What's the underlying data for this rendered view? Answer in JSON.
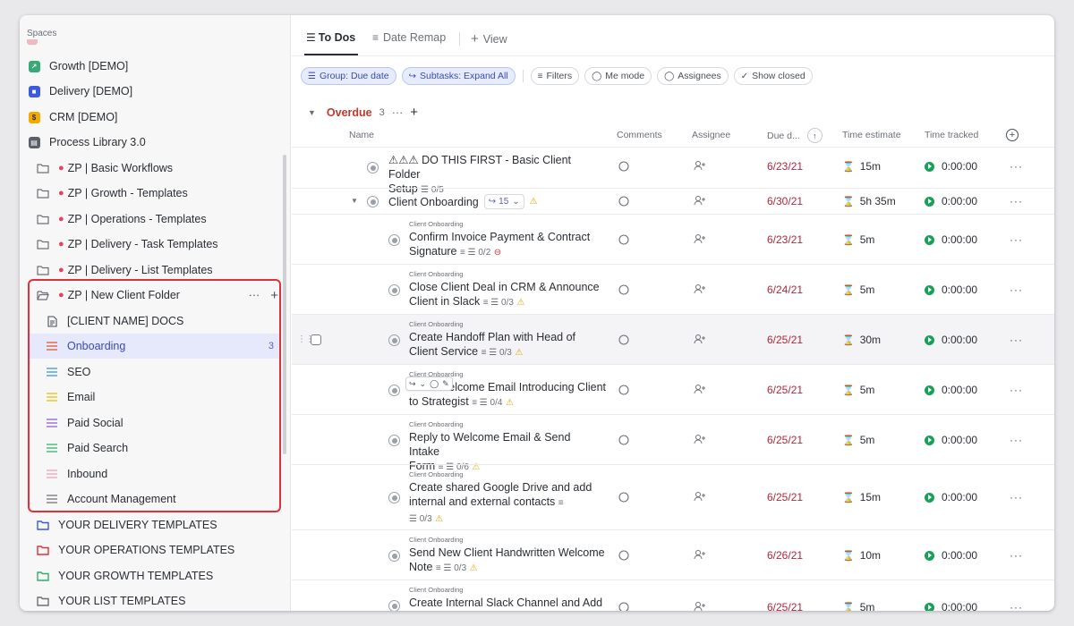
{
  "sidebar": {
    "spaces_label": "Spaces",
    "spaces": [
      {
        "label": "Growth [DEMO]",
        "color": "#3aa97a",
        "glyph": "⤴"
      },
      {
        "label": "Delivery [DEMO]",
        "color": "#3b5bdb",
        "glyph": "■"
      },
      {
        "label": "CRM [DEMO]",
        "color": "#f2a900",
        "glyph": "$"
      },
      {
        "label": "Process Library 3.0",
        "color": "#5a5f6a",
        "glyph": "▤"
      }
    ],
    "folders": [
      "ZP | Basic Workflows",
      "ZP | Growth - Templates",
      "ZP | Operations - Templates",
      "ZP | Delivery - Task Templates",
      "ZP | Delivery - List Templates"
    ],
    "open_folder": {
      "label": "ZP | New Client Folder",
      "more": "···",
      "add": "+"
    },
    "lists": [
      {
        "label": "[CLIENT NAME] DOCS",
        "type": "doc"
      },
      {
        "label": "Onboarding",
        "color": "#e0542b",
        "count": "3",
        "active": true
      },
      {
        "label": "SEO",
        "color": "#3b8fe0"
      },
      {
        "label": "Email",
        "color": "#e6c000"
      },
      {
        "label": "Paid Social",
        "color": "#8a5bd6"
      },
      {
        "label": "Paid Search",
        "color": "#2fae6b"
      },
      {
        "label": "Inbound",
        "color": "#f2a0b8"
      },
      {
        "label": "Account Management",
        "color": "#6b6f76"
      }
    ],
    "template_folders": [
      {
        "label": "YOUR DELIVERY TEMPLATES",
        "color": "#3b5bdb"
      },
      {
        "label": "YOUR OPERATIONS TEMPLATES",
        "color": "#e0303b"
      },
      {
        "label": "YOUR GROWTH TEMPLATES",
        "color": "#2fae6b"
      },
      {
        "label": "YOUR LIST TEMPLATES",
        "color": "#6b6f76"
      }
    ]
  },
  "tabs": {
    "todos": "To Dos",
    "date_remap": "Date Remap",
    "add_view": "View"
  },
  "toolbar": {
    "group": "Group: Due date",
    "subtasks": "Subtasks: Expand All",
    "filters": "Filters",
    "me_mode": "Me mode",
    "assignees": "Assignees",
    "show_closed": "Show closed"
  },
  "group": {
    "name": "Overdue",
    "count": "3",
    "more": "···",
    "add": "+"
  },
  "columns": {
    "name": "Name",
    "comments": "Comments",
    "assignee": "Assignee",
    "due": "Due d...",
    "time_estimate": "Time estimate",
    "time_tracked": "Time tracked"
  },
  "tasks": [
    {
      "parent": "",
      "line1": "⚠⚠⚠ DO THIS FIRST - Basic Client Folder",
      "line2": "Setup",
      "meta": "☰ 0/5",
      "flag": "",
      "due": "6/23/21",
      "estimate": "15m",
      "tracked": "0:00:00"
    },
    {
      "parent": "",
      "line1": "Client Onboarding",
      "line2": "",
      "meta": "15",
      "flag": "warn",
      "due": "6/30/21",
      "estimate": "5h 35m",
      "tracked": "0:00:00"
    },
    {
      "parent": "Client Onboarding",
      "line1": "Confirm Invoice Payment & Contract",
      "line2": "Signature",
      "meta": "≡ ☰ 0/2",
      "flag": "stop",
      "due": "6/23/21",
      "estimate": "5m",
      "tracked": "0:00:00"
    },
    {
      "parent": "Client Onboarding",
      "line1": "Close Client Deal in CRM & Announce",
      "line2": "Client in Slack",
      "meta": "≡ ☰ 0/3",
      "flag": "warn",
      "due": "6/24/21",
      "estimate": "5m",
      "tracked": "0:00:00"
    },
    {
      "parent": "Client Onboarding",
      "line1": "Create Handoff Plan with Head of",
      "line2": "Client Service",
      "meta": "≡ ☰ 0/3",
      "flag": "warn",
      "due": "6/25/21",
      "estimate": "30m",
      "tracked": "0:00:00"
    },
    {
      "parent": "Client Onboarding",
      "line1": "Send Welcome Email Introducing Client",
      "line2": "to Strategist",
      "meta": "≡ ☰ 0/4",
      "flag": "warn",
      "due": "6/25/21",
      "estimate": "5m",
      "tracked": "0:00:00"
    },
    {
      "parent": "Client Onboarding",
      "line1": "Reply to Welcome Email & Send Intake",
      "line2": "Form",
      "meta": "≡ ☰ 0/6",
      "flag": "warn",
      "due": "6/25/21",
      "estimate": "5m",
      "tracked": "0:00:00"
    },
    {
      "parent": "Client Onboarding",
      "line1": "Create shared Google Drive and add",
      "line2": "internal and external contacts",
      "line3": "☰ 0/3",
      "meta": "≡",
      "flag": "warn",
      "due": "6/25/21",
      "estimate": "15m",
      "tracked": "0:00:00"
    },
    {
      "parent": "Client Onboarding",
      "line1": "Send New Client Handwritten Welcome",
      "line2": "Note",
      "meta": "≡ ☰ 0/3",
      "flag": "warn",
      "due": "6/26/21",
      "estimate": "10m",
      "tracked": "0:00:00"
    },
    {
      "parent": "Client Onboarding",
      "line1": "Create Internal Slack Channel and Add",
      "line2": "",
      "meta": "",
      "flag": "",
      "due": "6/25/21",
      "estimate": "5m",
      "tracked": "0:00:00"
    }
  ],
  "row_more": "···"
}
